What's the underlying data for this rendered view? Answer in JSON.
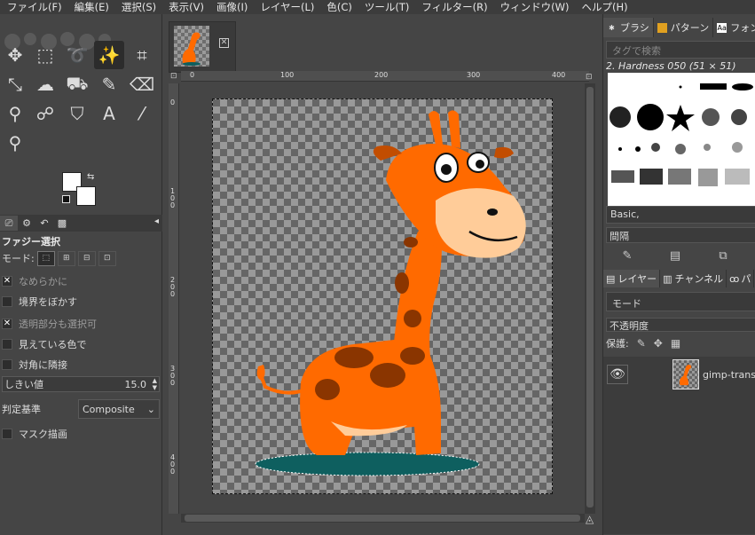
{
  "menu": [
    "ファイル(F)",
    "編集(E)",
    "選択(S)",
    "表示(V)",
    "画像(I)",
    "レイヤー(L)",
    "色(C)",
    "ツール(T)",
    "フィルター(R)",
    "ウィンドウ(W)",
    "ヘルプ(H)"
  ],
  "tools": [
    {
      "name": "move-tool-icon",
      "glyph": "✥"
    },
    {
      "name": "rect-select-icon",
      "glyph": "⬚"
    },
    {
      "name": "lasso-icon",
      "glyph": "➰"
    },
    {
      "name": "fuzzy-select-icon",
      "glyph": "✨"
    },
    {
      "name": "crop-icon",
      "glyph": "⌗"
    },
    {
      "name": "transform-icon",
      "glyph": "⤡"
    },
    {
      "name": "warp-icon",
      "glyph": "☁"
    },
    {
      "name": "bucket-fill-icon",
      "glyph": "⛟"
    },
    {
      "name": "paintbrush-icon",
      "glyph": "✎"
    },
    {
      "name": "eraser-icon",
      "glyph": "⌫"
    },
    {
      "name": "clone-icon",
      "glyph": "⚲"
    },
    {
      "name": "smudge-icon",
      "glyph": "☍"
    },
    {
      "name": "dodge-icon",
      "glyph": "⛉"
    },
    {
      "name": "text-tool-icon",
      "glyph": "A"
    },
    {
      "name": "color-picker-icon",
      "glyph": "⁄"
    },
    {
      "name": "zoom-icon",
      "glyph": "⚲"
    }
  ],
  "tool_options": {
    "title": "ファジー選択",
    "mode_label": "モード:",
    "antialias": "なめらかに",
    "feather": "境界をぼかす",
    "transparent": "透明部分も選択可",
    "visible": "見えている色で",
    "diagonal": "対角に隣接",
    "threshold_label": "しきい値",
    "threshold_value": "15.0",
    "criterion_label": "判定基準",
    "criterion_value": "Composite",
    "draw_mask": "マスク描画"
  },
  "ruler": {
    "h": [
      "0",
      "100",
      "200",
      "300",
      "400"
    ],
    "v": [
      "0",
      "1\n0\n0",
      "2\n0\n0",
      "3\n0\n0",
      "4\n0\n0"
    ]
  },
  "brushes": {
    "tab_brush": "ブラシ",
    "tab_pattern": "パターン",
    "tab_font": "フォン",
    "tag_placeholder": "タグで検索",
    "current": "2. Hardness 050 (51 × 51)",
    "preset": "Basic,",
    "spacing": "間隔"
  },
  "layers": {
    "tab_layers": "レイヤー",
    "tab_channels": "チャンネル",
    "tab_paths": "パ",
    "mode": "モード",
    "opacity": "不透明度",
    "lock": "保護:",
    "layer_name": "gimp-trans"
  },
  "colors": {
    "giraffe_body": "#ff6a00",
    "giraffe_spot": "#8a3500",
    "muzzle": "#ffcc99",
    "shadow": "#0e5f5f"
  }
}
